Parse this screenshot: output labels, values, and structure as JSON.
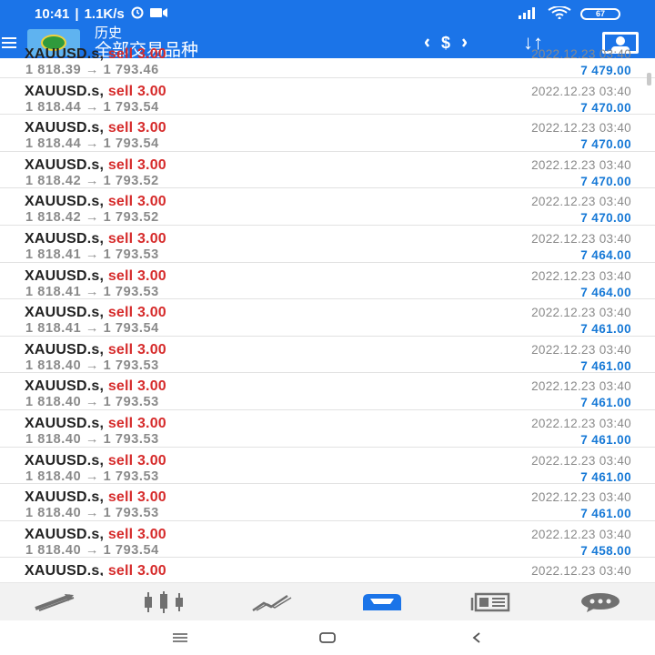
{
  "status": {
    "time": "10:41",
    "speed": "1.1K/s",
    "battery": "67"
  },
  "header": {
    "title": "历史",
    "subtitle": "全部交易品种",
    "sort_label": "↓↑"
  },
  "rows": [
    {
      "symbol": "XAUUSD.s,",
      "side": "sell 3.00",
      "open": "1 818.39",
      "close": "1 793.46",
      "time": "2022.12.23 03:40",
      "profit": "7 479.00"
    },
    {
      "symbol": "XAUUSD.s,",
      "side": "sell 3.00",
      "open": "1 818.44",
      "close": "1 793.54",
      "time": "2022.12.23 03:40",
      "profit": "7 470.00"
    },
    {
      "symbol": "XAUUSD.s,",
      "side": "sell 3.00",
      "open": "1 818.44",
      "close": "1 793.54",
      "time": "2022.12.23 03:40",
      "profit": "7 470.00"
    },
    {
      "symbol": "XAUUSD.s,",
      "side": "sell 3.00",
      "open": "1 818.42",
      "close": "1 793.52",
      "time": "2022.12.23 03:40",
      "profit": "7 470.00"
    },
    {
      "symbol": "XAUUSD.s,",
      "side": "sell 3.00",
      "open": "1 818.42",
      "close": "1 793.52",
      "time": "2022.12.23 03:40",
      "profit": "7 470.00"
    },
    {
      "symbol": "XAUUSD.s,",
      "side": "sell 3.00",
      "open": "1 818.41",
      "close": "1 793.53",
      "time": "2022.12.23 03:40",
      "profit": "7 464.00"
    },
    {
      "symbol": "XAUUSD.s,",
      "side": "sell 3.00",
      "open": "1 818.41",
      "close": "1 793.53",
      "time": "2022.12.23 03:40",
      "profit": "7 464.00"
    },
    {
      "symbol": "XAUUSD.s,",
      "side": "sell 3.00",
      "open": "1 818.41",
      "close": "1 793.54",
      "time": "2022.12.23 03:40",
      "profit": "7 461.00"
    },
    {
      "symbol": "XAUUSD.s,",
      "side": "sell 3.00",
      "open": "1 818.40",
      "close": "1 793.53",
      "time": "2022.12.23 03:40",
      "profit": "7 461.00"
    },
    {
      "symbol": "XAUUSD.s,",
      "side": "sell 3.00",
      "open": "1 818.40",
      "close": "1 793.53",
      "time": "2022.12.23 03:40",
      "profit": "7 461.00"
    },
    {
      "symbol": "XAUUSD.s,",
      "side": "sell 3.00",
      "open": "1 818.40",
      "close": "1 793.53",
      "time": "2022.12.23 03:40",
      "profit": "7 461.00"
    },
    {
      "symbol": "XAUUSD.s,",
      "side": "sell 3.00",
      "open": "1 818.40",
      "close": "1 793.53",
      "time": "2022.12.23 03:40",
      "profit": "7 461.00"
    },
    {
      "symbol": "XAUUSD.s,",
      "side": "sell 3.00",
      "open": "1 818.40",
      "close": "1 793.53",
      "time": "2022.12.23 03:40",
      "profit": "7 461.00"
    },
    {
      "symbol": "XAUUSD.s,",
      "side": "sell 3.00",
      "open": "1 818.40",
      "close": "1 793.54",
      "time": "2022.12.23 03:40",
      "profit": "7 458.00"
    },
    {
      "symbol": "XAUUSD.s,",
      "side": "sell 3.00",
      "open": "",
      "close": "",
      "time": "2022.12.23 03:40",
      "profit": ""
    }
  ],
  "icons": {
    "tabs": [
      "quotes-icon",
      "chart-icon",
      "trade-icon",
      "history-icon",
      "news-icon",
      "messages-icon"
    ],
    "active_tab": "history-icon"
  },
  "colors": {
    "header_bg": "#1b74e8",
    "sell": "#d62b2b",
    "profit": "#1578d6",
    "active_tab": "#1b74e8",
    "inactive_tab": "#707070"
  }
}
